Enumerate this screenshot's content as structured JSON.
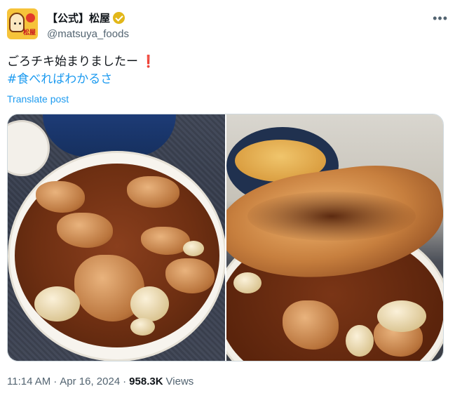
{
  "account": {
    "display_name": "【公式】松屋",
    "handle": "@matsuya_foods",
    "avatar_text": "松屋"
  },
  "tweet": {
    "text": "ごろチキ始まりましたー",
    "hashtag": "#食べればわかるさ",
    "translate_label": "Translate post"
  },
  "meta": {
    "time": "11:14 AM",
    "separator": "·",
    "date": "Apr 16, 2024",
    "views_count": "958.3K",
    "views_label": "Views"
  },
  "icons": {
    "more": "more-icon",
    "verified": "verified-badge-icon",
    "exclamation": "red-exclamation-icon"
  },
  "colors": {
    "link": "#1d9bf0",
    "verified_gold": "#e2b719",
    "secondary_text": "#536471",
    "exclamation": "#d62d3a"
  }
}
